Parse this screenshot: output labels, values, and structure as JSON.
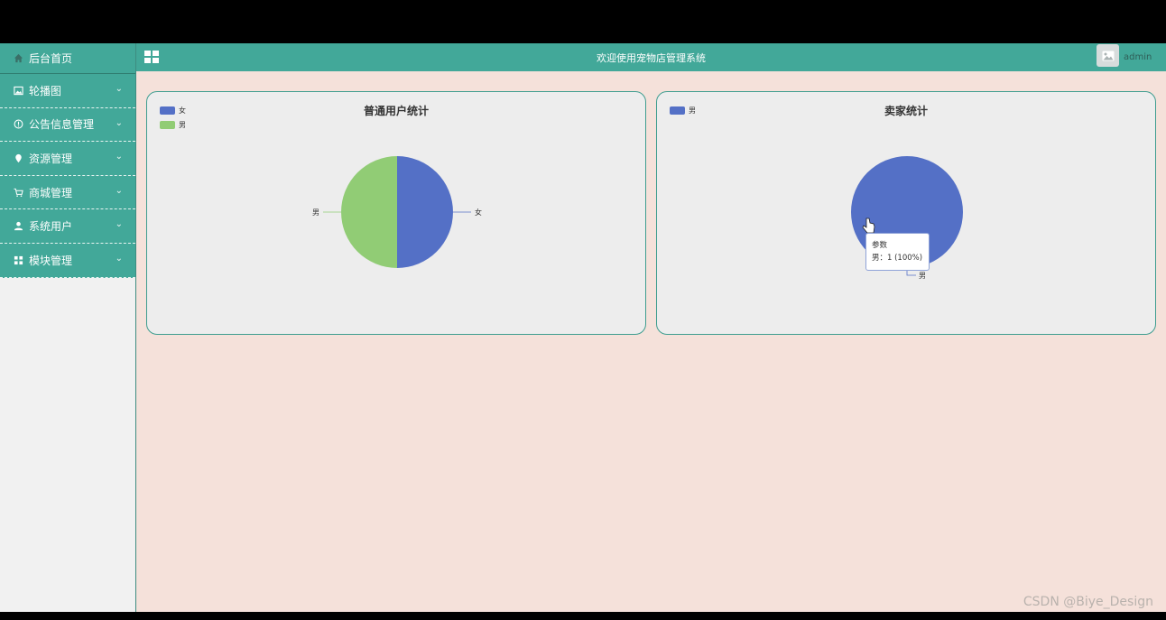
{
  "sidebar": {
    "home": {
      "label": "后台首页",
      "icon": "home-icon"
    },
    "items": [
      {
        "label": "轮播图",
        "icon": "image-icon"
      },
      {
        "label": "公告信息管理",
        "icon": "info-icon"
      },
      {
        "label": "资源管理",
        "icon": "location-pin-icon"
      },
      {
        "label": "商城管理",
        "icon": "cart-icon"
      },
      {
        "label": "系统用户",
        "icon": "user-icon"
      },
      {
        "label": "模块管理",
        "icon": "grid-icon"
      }
    ]
  },
  "topbar": {
    "title": "欢迎使用宠物店管理系统",
    "username": "admin"
  },
  "colors": {
    "accent": "#42a899",
    "female": "#5470c6",
    "male": "#91cc75",
    "background": "#f5e1da"
  },
  "chart_data": [
    {
      "type": "pie",
      "title": "普通用户统计",
      "legend": "top-left",
      "slices": [
        {
          "name": "女",
          "value": 1,
          "color": "#5470c6"
        },
        {
          "name": "男",
          "value": 1,
          "color": "#91cc75"
        }
      ]
    },
    {
      "type": "pie",
      "title": "卖家统计",
      "legend": "top-left",
      "slices": [
        {
          "name": "男",
          "value": 1,
          "color": "#5470c6"
        }
      ],
      "tooltip": {
        "header": "参数",
        "text": "男：1 (100%)"
      }
    }
  ],
  "watermark": "CSDN @Biye_Design"
}
